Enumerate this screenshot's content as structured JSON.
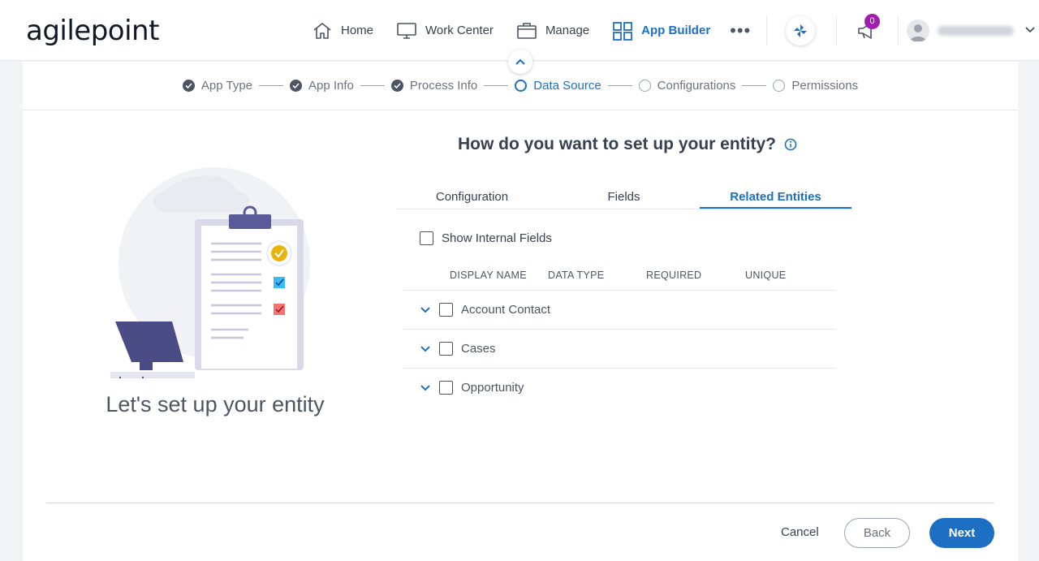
{
  "brand": {
    "logo_text": "agilepoint"
  },
  "nav": {
    "items": [
      {
        "label": "Home",
        "icon": "home-icon"
      },
      {
        "label": "Work Center",
        "icon": "monitor-icon"
      },
      {
        "label": "Manage",
        "icon": "briefcase-icon"
      },
      {
        "label": "App Builder",
        "icon": "grid-icon",
        "active": true
      }
    ],
    "more": "•••"
  },
  "header": {
    "notification_count": "0"
  },
  "stepper": {
    "steps": [
      {
        "label": "App Type",
        "state": "done"
      },
      {
        "label": "App Info",
        "state": "done"
      },
      {
        "label": "Process Info",
        "state": "done"
      },
      {
        "label": "Data Source",
        "state": "current"
      },
      {
        "label": "Configurations",
        "state": "todo"
      },
      {
        "label": "Permissions",
        "state": "todo"
      }
    ]
  },
  "left": {
    "title": "Let's set up your entity"
  },
  "main": {
    "question": "How do you want to set up your entity?",
    "tabs": [
      "Configuration",
      "Fields",
      "Related Entities"
    ],
    "active_tab": "Related Entities",
    "show_internal_label": "Show Internal Fields",
    "columns": [
      "DISPLAY NAME",
      "DATA TYPE",
      "REQUIRED",
      "UNIQUE"
    ],
    "rows": [
      "Account Contact",
      "Cases",
      "Opportunity"
    ]
  },
  "footer": {
    "cancel": "Cancel",
    "back": "Back",
    "next": "Next"
  },
  "colors": {
    "accent": "#1d6fc4",
    "badge": "#a21caf",
    "check_yellow": "#eab308",
    "check_blue": "#38bdf8",
    "check_red": "#f87171"
  }
}
